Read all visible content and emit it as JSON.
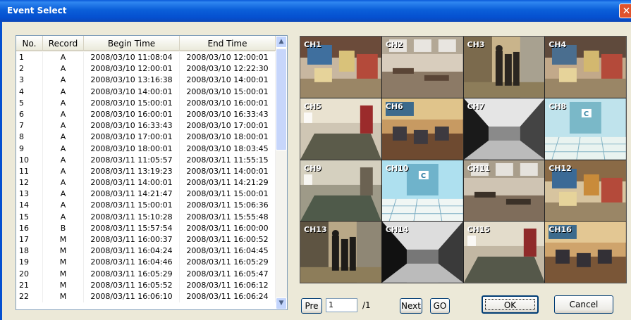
{
  "window": {
    "title": "Event Select",
    "close_glyph": "✕"
  },
  "table": {
    "headers": {
      "no": "No.",
      "record": "Record",
      "begin": "Begin Time",
      "end": "End Time"
    },
    "rows": [
      {
        "no": "1",
        "record": "A",
        "begin": "2008/03/10 11:08:04",
        "end": "2008/03/10 12:00:01"
      },
      {
        "no": "2",
        "record": "A",
        "begin": "2008/03/10 12:00:01",
        "end": "2008/03/10 12:22:30"
      },
      {
        "no": "3",
        "record": "A",
        "begin": "2008/03/10 13:16:38",
        "end": "2008/03/10 14:00:01"
      },
      {
        "no": "4",
        "record": "A",
        "begin": "2008/03/10 14:00:01",
        "end": "2008/03/10 15:00:01"
      },
      {
        "no": "5",
        "record": "A",
        "begin": "2008/03/10 15:00:01",
        "end": "2008/03/10 16:00:01"
      },
      {
        "no": "6",
        "record": "A",
        "begin": "2008/03/10 16:00:01",
        "end": "2008/03/10 16:33:43"
      },
      {
        "no": "7",
        "record": "A",
        "begin": "2008/03/10 16:33:43",
        "end": "2008/03/10 17:00:01"
      },
      {
        "no": "8",
        "record": "A",
        "begin": "2008/03/10 17:00:01",
        "end": "2008/03/10 18:00:01"
      },
      {
        "no": "9",
        "record": "A",
        "begin": "2008/03/10 18:00:01",
        "end": "2008/03/10 18:03:45"
      },
      {
        "no": "10",
        "record": "A",
        "begin": "2008/03/11 11:05:57",
        "end": "2008/03/11 11:55:15"
      },
      {
        "no": "11",
        "record": "A",
        "begin": "2008/03/11 13:19:23",
        "end": "2008/03/11 14:00:01"
      },
      {
        "no": "12",
        "record": "A",
        "begin": "2008/03/11 14:00:01",
        "end": "2008/03/11 14:21:29"
      },
      {
        "no": "13",
        "record": "A",
        "begin": "2008/03/11 14:21:47",
        "end": "2008/03/11 15:00:01"
      },
      {
        "no": "14",
        "record": "A",
        "begin": "2008/03/11 15:00:01",
        "end": "2008/03/11 15:06:36"
      },
      {
        "no": "15",
        "record": "A",
        "begin": "2008/03/11 15:10:28",
        "end": "2008/03/11 15:55:48"
      },
      {
        "no": "16",
        "record": "B",
        "begin": "2008/03/11 15:57:54",
        "end": "2008/03/11 16:00:00"
      },
      {
        "no": "17",
        "record": "M",
        "begin": "2008/03/11 16:00:37",
        "end": "2008/03/11 16:00:52"
      },
      {
        "no": "18",
        "record": "M",
        "begin": "2008/03/11 16:04:24",
        "end": "2008/03/11 16:04:45"
      },
      {
        "no": "19",
        "record": "M",
        "begin": "2008/03/11 16:04:46",
        "end": "2008/03/11 16:05:29"
      },
      {
        "no": "20",
        "record": "M",
        "begin": "2008/03/11 16:05:29",
        "end": "2008/03/11 16:05:47"
      },
      {
        "no": "21",
        "record": "M",
        "begin": "2008/03/11 16:05:52",
        "end": "2008/03/11 16:06:12"
      },
      {
        "no": "22",
        "record": "M",
        "begin": "2008/03/11 16:06:10",
        "end": "2008/03/11 16:06:24"
      }
    ]
  },
  "scrollbar": {
    "up_glyph": "▲",
    "down_glyph": "▼"
  },
  "channels": [
    {
      "label": "CH1",
      "scene": "classroom-toys",
      "colors": [
        "#6b4b3a",
        "#c8b7a0",
        "#3f6f9e",
        "#d9c27a"
      ]
    },
    {
      "label": "CH2",
      "scene": "classroom-desks",
      "colors": [
        "#8c7a66",
        "#d8cdbd",
        "#5a4536",
        "#b3a896"
      ]
    },
    {
      "label": "CH3",
      "scene": "hallway-people",
      "colors": [
        "#7b6a4d",
        "#c9b48b",
        "#2b2620",
        "#a8a190"
      ]
    },
    {
      "label": "CH4",
      "scene": "classroom-toys",
      "colors": [
        "#5f4a3c",
        "#c2a98a",
        "#4a6e8f",
        "#d3b86f"
      ]
    },
    {
      "label": "CH5",
      "scene": "room-carpet",
      "colors": [
        "#cfc6b4",
        "#5b5b4a",
        "#9b2b2b",
        "#e9e2d0"
      ]
    },
    {
      "label": "CH6",
      "scene": "classroom-chairs",
      "colors": [
        "#6e4a30",
        "#c79a62",
        "#3d3a40",
        "#e0c48b"
      ]
    },
    {
      "label": "CH7",
      "scene": "bw-hallway",
      "colors": [
        "#1a1a1a",
        "#8a8a8a",
        "#e5e5e5",
        "#444444"
      ]
    },
    {
      "label": "CH8",
      "scene": "elevator-tiles",
      "colors": [
        "#bfe3ec",
        "#3f8aa8",
        "#e9f3f0",
        "#7ab8c8"
      ]
    },
    {
      "label": "CH9",
      "scene": "room-carpet",
      "colors": [
        "#9e9a88",
        "#4f5a4a",
        "#6b6252",
        "#d5d0bf"
      ]
    },
    {
      "label": "CH10",
      "scene": "elevator-tiles",
      "colors": [
        "#aee0ef",
        "#2f7da3",
        "#f0f6f4",
        "#6fb3cb"
      ]
    },
    {
      "label": "CH11",
      "scene": "classroom-desks",
      "colors": [
        "#7f6d5b",
        "#cfc4b3",
        "#3b3128",
        "#a99e8b"
      ]
    },
    {
      "label": "CH12",
      "scene": "classroom-toys",
      "colors": [
        "#8a6a46",
        "#d7c49f",
        "#3b6a96",
        "#c98b3a"
      ]
    },
    {
      "label": "CH13",
      "scene": "hallway-people",
      "colors": [
        "#5e5442",
        "#b9a887",
        "#1e1c19",
        "#8f8775"
      ]
    },
    {
      "label": "CH14",
      "scene": "bw-hallway",
      "colors": [
        "#111111",
        "#777777",
        "#dddddd",
        "#3a3a3a"
      ]
    },
    {
      "label": "CH15",
      "scene": "room-carpet",
      "colors": [
        "#c2b7a3",
        "#55584a",
        "#8f2a2a",
        "#e3dccb"
      ]
    },
    {
      "label": "CH16",
      "scene": "classroom-chairs",
      "colors": [
        "#7a5637",
        "#cfa46c",
        "#333036",
        "#e3c793"
      ]
    }
  ],
  "pager": {
    "pre_label": "Pre",
    "page_value": "1",
    "total_label": "/1",
    "next_label": "Next",
    "go_label": "GO"
  },
  "dialog_buttons": {
    "ok_label": "OK",
    "cancel_label": "Cancel"
  }
}
